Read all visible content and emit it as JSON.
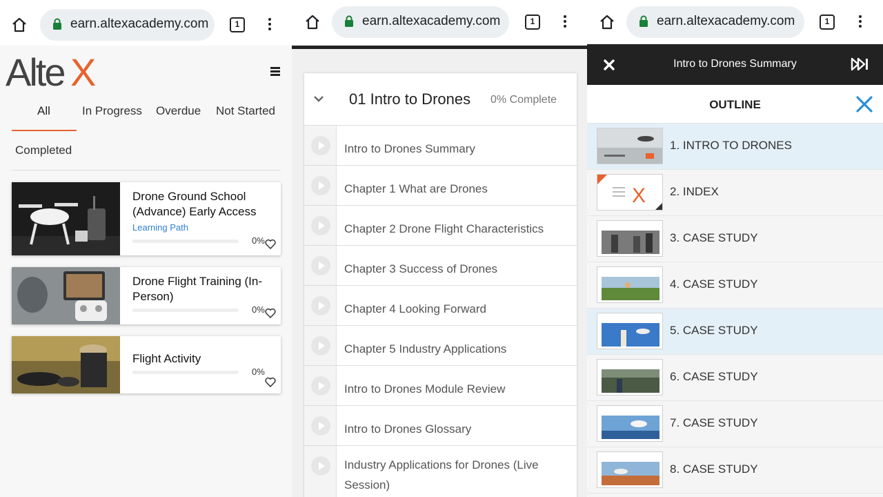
{
  "browser": {
    "url_text": "earn.altexacademy.com",
    "tab_count": "1"
  },
  "panel1": {
    "logo_text": "AlteX",
    "filter_tabs": [
      "All",
      "In Progress",
      "Overdue",
      "Not Started",
      "Completed"
    ],
    "active_tab": "All",
    "courses": [
      {
        "title": "Drone Ground School (Advance) Early Access",
        "type": "Learning Path",
        "progress_label": "0%",
        "progress": 0
      },
      {
        "title": "Drone Flight Training (In-Person)",
        "type": "",
        "progress_label": "0%",
        "progress": 0
      },
      {
        "title": "Flight Activity",
        "type": "",
        "progress_label": "0%",
        "progress": 0
      }
    ]
  },
  "panel2": {
    "module_title": "01 Intro to Drones",
    "module_progress": "0% Complete",
    "lessons": [
      "Intro to Drones Summary",
      "Chapter 1 What are Drones",
      "Chapter 2 Drone Flight Characteristics",
      "Chapter 3 Success of Drones",
      "Chapter 4 Looking Forward",
      "Chapter 5 Industry Applications",
      "Intro to Drones Module Review",
      "Intro to Drones Glossary",
      "Industry Applications for Drones (Live Session)"
    ]
  },
  "panel3": {
    "player_title": "Intro to Drones Summary",
    "outline_title": "OUTLINE",
    "slides": [
      "1. INTRO TO DRONES",
      "2. INDEX",
      "3. CASE STUDY",
      "4. CASE STUDY",
      "5. CASE STUDY",
      "6. CASE STUDY",
      "7. CASE STUDY",
      "8. CASE STUDY"
    ],
    "highlighted_slides": [
      1,
      5
    ]
  },
  "colors": {
    "brand_orange": "#e8622d",
    "link_blue": "#2f7fd1",
    "close_blue": "#2b8fd6",
    "lock_green": "#188038"
  }
}
